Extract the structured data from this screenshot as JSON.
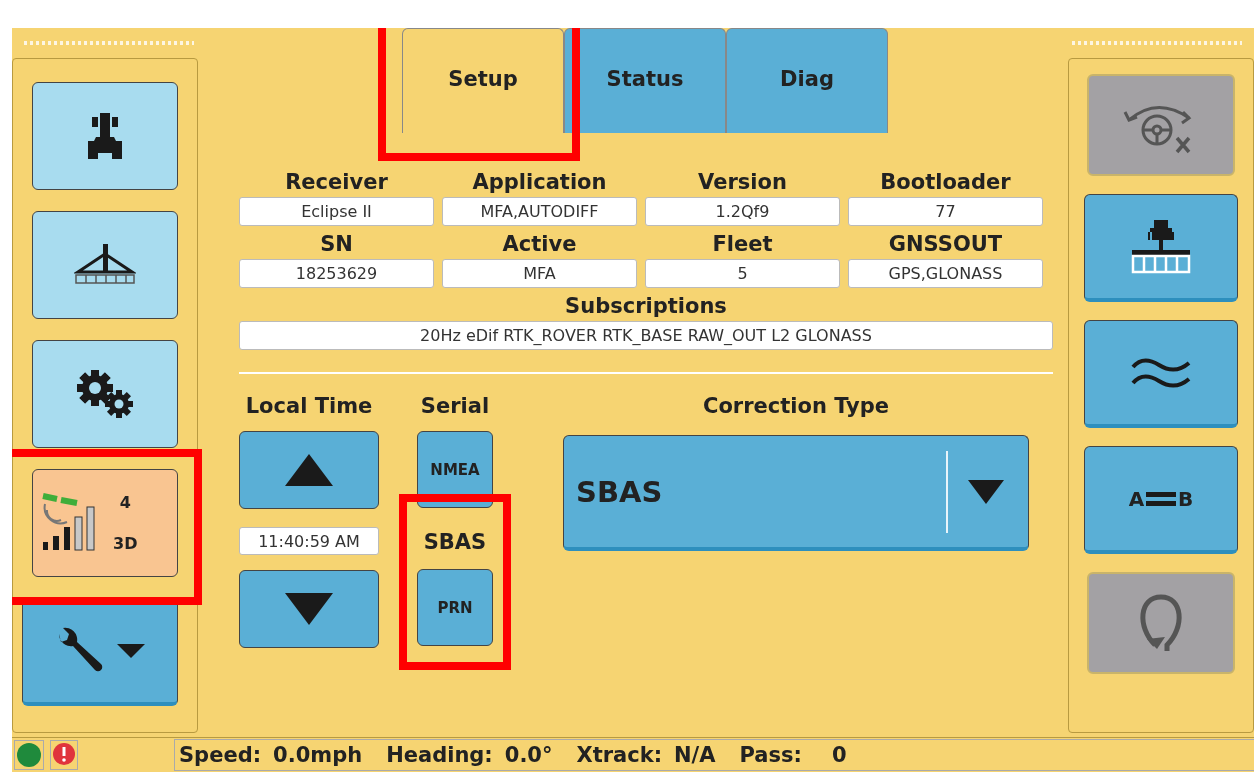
{
  "tabs": [
    {
      "label": "Setup",
      "selected": true,
      "highlighted": true
    },
    {
      "label": "Status",
      "selected": false,
      "highlighted": false
    },
    {
      "label": "Diag",
      "selected": false,
      "highlighted": false
    }
  ],
  "left_toolbar": [
    {
      "kind": "tractor",
      "highlighted": false
    },
    {
      "kind": "implement",
      "highlighted": false
    },
    {
      "kind": "settings",
      "highlighted": false
    },
    {
      "kind": "gps_status",
      "highlighted": true,
      "satellites": "4",
      "fix": "3D"
    },
    {
      "kind": "tools_menu",
      "highlighted": false
    }
  ],
  "right_toolbar": [
    {
      "kind": "steering",
      "disabled": true
    },
    {
      "kind": "tractor_implement",
      "disabled": false
    },
    {
      "kind": "waves",
      "disabled": false
    },
    {
      "kind": "ab_line",
      "disabled": false,
      "labels": [
        "A",
        "B"
      ]
    },
    {
      "kind": "u_turn",
      "disabled": true
    }
  ],
  "receiver_info": {
    "fields": [
      {
        "label": "Receiver",
        "value": "Eclipse II"
      },
      {
        "label": "Application",
        "value": "MFA,AUTODIFF"
      },
      {
        "label": "Version",
        "value": "1.2Qf9"
      },
      {
        "label": "Bootloader",
        "value": "77"
      },
      {
        "label": "SN",
        "value": "18253629"
      },
      {
        "label": "Active",
        "value": "MFA"
      },
      {
        "label": "Fleet",
        "value": "5"
      },
      {
        "label": "GNSSOUT",
        "value": "GPS,GLONASS"
      }
    ],
    "subscriptions": {
      "label": "Subscriptions",
      "value": "20Hz eDif RTK_ROVER RTK_BASE RAW_OUT L2 GLONASS"
    }
  },
  "local_time": {
    "label": "Local Time",
    "value": "11:40:59 AM"
  },
  "serial": {
    "label": "Serial",
    "button": "NMEA"
  },
  "sbas": {
    "label": "SBAS",
    "button": "PRN",
    "highlighted": true
  },
  "correction_type": {
    "label": "Correction Type",
    "value": "SBAS"
  },
  "status_lights": [
    {
      "kind": "ok",
      "color": "#1f8a3c"
    },
    {
      "kind": "alert",
      "color": "#e0343c"
    }
  ],
  "status_bar": [
    {
      "label": "Speed:",
      "value": "0.0mph"
    },
    {
      "label": "Heading:",
      "value": "0.0°"
    },
    {
      "label": "Xtrack:",
      "value": "N/A"
    },
    {
      "label": "Pass:",
      "value": "0"
    }
  ]
}
